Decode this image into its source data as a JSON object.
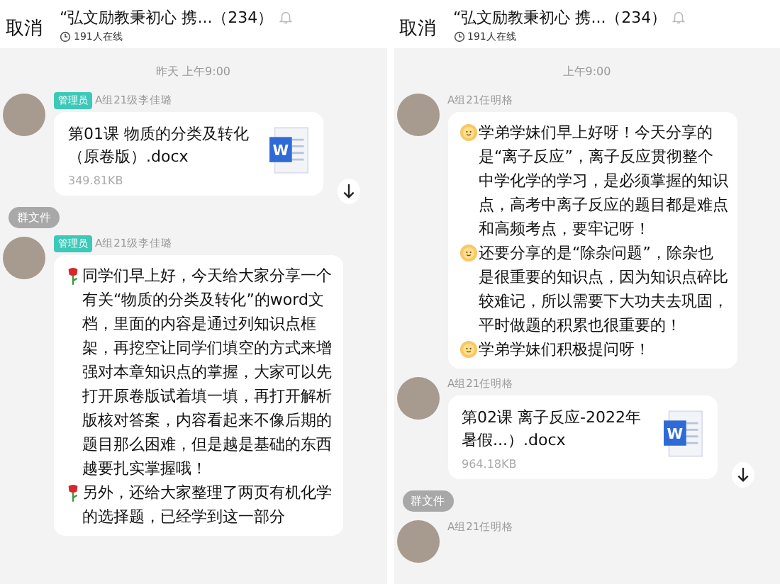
{
  "panels": [
    {
      "header": {
        "cancel": "取消",
        "title": "“弘文励教秉初心 携...（234）",
        "online": "191人在线"
      },
      "timestamp": "昨天 上午9:00",
      "messages": [
        {
          "kind": "file",
          "admin_badge": "管理员",
          "sender": "A组21级李佳璐",
          "file_name": "第01课 物质的分类及转化（原卷版）.docx",
          "file_icon_letter": "W",
          "file_size": "349.81KB",
          "tag": "群文件"
        },
        {
          "kind": "text",
          "admin_badge": "管理员",
          "sender": "A组21级李佳璐",
          "paragraphs": [
            {
              "kind": "rose",
              "text": "同学们早上好，今天给大家分享一个有关“物质的分类及转化”的word文档，里面的内容是通过列知识点框架，再挖空让同学们填空的方式来增强对本章知识点的掌握，大家可以先打开原卷版试着填一填，再打开解析版核对答案，内容看起来不像后期的题目那么困难，但是越是基础的东西越要扎实掌握哦！"
            },
            {
              "kind": "rose",
              "text": "另外，还给大家整理了两页有机化学的选择题，已经学到这一部分"
            }
          ]
        }
      ]
    },
    {
      "header": {
        "cancel": "取消",
        "title": "“弘文励教秉初心 携...（234）",
        "online": "191人在线"
      },
      "timestamp": "上午9:00",
      "messages": [
        {
          "kind": "text",
          "sender": "A组21任明格",
          "paragraphs": [
            {
              "kind": "sun",
              "text": "学弟学妹们早上好呀！今天分享的是“离子反应”，离子反应贯彻整个中学化学的学习，是必须掌握的知识点，高考中离子反应的题目都是难点和高频考点，要牢记呀！"
            },
            {
              "kind": "sun",
              "text": "还要分享的是“除杂问题”，除杂也是很重要的知识点，因为知识点碎比较难记，所以需要下大功夫去巩固，平时做题的积累也很重要的！"
            },
            {
              "kind": "sun",
              "text": "学弟学妹们积极提问呀！"
            }
          ]
        },
        {
          "kind": "file",
          "sender": "A组21任明格",
          "file_name": "第02课 离子反应-2022年暑假...）.docx",
          "file_icon_letter": "W",
          "file_size": "964.18KB",
          "tag": "群文件"
        },
        {
          "kind": "text",
          "sender": "A组21任明格"
        }
      ]
    }
  ]
}
